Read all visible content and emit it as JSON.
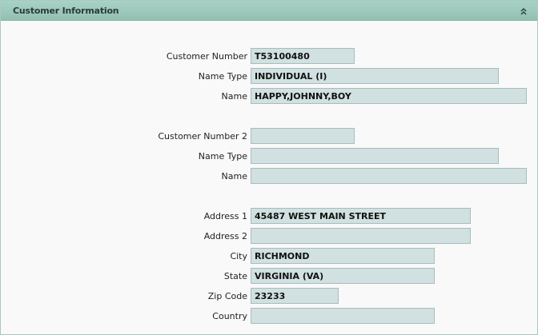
{
  "panel": {
    "title": "Customer Information",
    "collapse_icon": "chevron-double-up-icon"
  },
  "customer1": {
    "number_label": "Customer Number",
    "number_value": "T53100480",
    "name_type_label": "Name Type",
    "name_type_value": "INDIVIDUAL (I)",
    "name_label": "Name",
    "name_value": "HAPPY,JOHNNY,BOY"
  },
  "customer2": {
    "number_label": "Customer Number 2",
    "number_value": "",
    "name_type_label": "Name Type",
    "name_type_value": "",
    "name_label": "Name",
    "name_value": ""
  },
  "address": {
    "address1_label": "Address 1",
    "address1_value": "45487 WEST MAIN STREET",
    "address2_label": "Address 2",
    "address2_value": "",
    "city_label": "City",
    "city_value": "RICHMOND",
    "state_label": "State",
    "state_value": "VIRGINIA (VA)",
    "zip_label": "Zip Code",
    "zip_value": "23233",
    "country_label": "Country",
    "country_value": ""
  },
  "colors": {
    "header_bg": "#a8d2c6",
    "field_bg": "#d1e0e0",
    "field_border": "#a8bcbc"
  }
}
